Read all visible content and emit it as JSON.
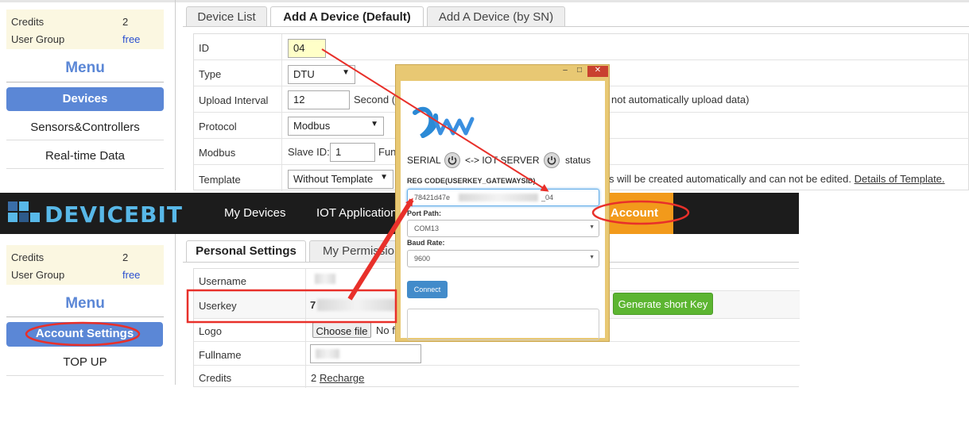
{
  "top": {
    "info": {
      "credits_label": "Credits",
      "credits_value": "2",
      "group_label": "User Group",
      "group_value": "free"
    },
    "menu_title": "Menu",
    "menu_items": [
      "Devices",
      "Sensors&Controllers",
      "Real-time Data"
    ],
    "tabs": [
      "Device List",
      "Add A Device (Default)",
      "Add A Device (by SN)"
    ],
    "form": {
      "id_label": "ID",
      "id_value": "04",
      "type_label": "Type",
      "type_value": "DTU",
      "interval_label": "Upload Interval",
      "interval_value": "12",
      "interval_unit": "Second (",
      "interval_note": "not automatically upload data)",
      "protocol_label": "Protocol",
      "protocol_value": "Modbus",
      "modbus_label": "Modbus",
      "slave_label": "Slave ID:",
      "slave_value": "1",
      "modbus_extra": "Fun",
      "template_label": "Template",
      "template_value": "Without Template",
      "template_note": "s will be created automatically and can not be edited.",
      "template_link": "Details of Template."
    }
  },
  "navbar": {
    "logo": "DEVICEBIT",
    "items": [
      "My Devices",
      "IOT Application",
      "Account"
    ]
  },
  "bottom": {
    "info": {
      "credits_label": "Credits",
      "credits_value": "2",
      "group_label": "User Group",
      "group_value": "free"
    },
    "menu_title": "Menu",
    "menu_items": [
      "Account Settings",
      "TOP UP"
    ],
    "tabs": [
      "Personal Settings",
      "My Permissio"
    ],
    "form": {
      "username_label": "Username",
      "userkey_label": "Userkey",
      "userkey_prefix": "7",
      "generate_button": "Generate short Key",
      "logo_label": "Logo",
      "choose_file": "Choose file",
      "no_file": "No f",
      "fullname_label": "Fullname",
      "credits_label": "Credits",
      "credits_value": "2",
      "recharge_link": "Recharge"
    }
  },
  "popup": {
    "window_controls": [
      "–",
      "□",
      "✕"
    ],
    "serial_label": "SERIAL",
    "arrow_text": "<-> IOT SERVER",
    "status_label": "status",
    "reg_label": "REG CODE(USERKEY_GATEWAYSID)",
    "reg_value_start": "78421d47e",
    "reg_value_end": "_04",
    "port_label": "Port Path:",
    "port_value": "COM13",
    "baud_label": "Baud Rate:",
    "baud_value": "9600",
    "connect_button": "Connect"
  },
  "colors": {
    "accent_blue": "#5b87d6",
    "nav_orange": "#f29a1b",
    "annotation_red": "#e8302a",
    "button_green": "#5cb531",
    "logo_blue": "#58b8e8"
  }
}
